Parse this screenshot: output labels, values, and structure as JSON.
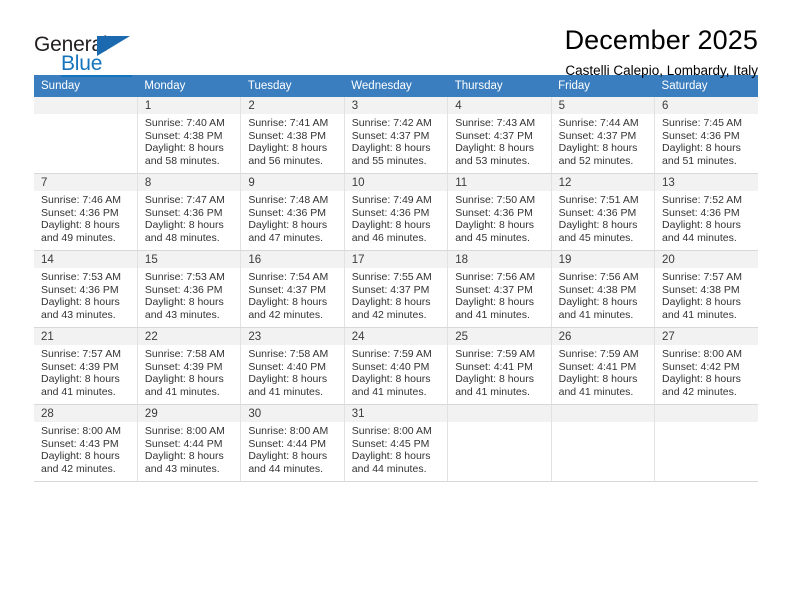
{
  "brand": {
    "name_top": "General",
    "name_bottom": "Blue",
    "accent_color": "#1574bb",
    "triangle_color": "#1b69af"
  },
  "header": {
    "title": "December 2025",
    "subtitle": "Castelli Calepio, Lombardy, Italy"
  },
  "calendar": {
    "header_bg": "#3a7ebf",
    "daynum_bg": "#f2f2f2",
    "weekdays": [
      "Sunday",
      "Monday",
      "Tuesday",
      "Wednesday",
      "Thursday",
      "Friday",
      "Saturday"
    ],
    "weeks": [
      [
        {
          "day": "",
          "sunrise": "",
          "sunset": "",
          "daylight": ""
        },
        {
          "day": "1",
          "sunrise": "Sunrise: 7:40 AM",
          "sunset": "Sunset: 4:38 PM",
          "daylight": "Daylight: 8 hours and 58 minutes."
        },
        {
          "day": "2",
          "sunrise": "Sunrise: 7:41 AM",
          "sunset": "Sunset: 4:38 PM",
          "daylight": "Daylight: 8 hours and 56 minutes."
        },
        {
          "day": "3",
          "sunrise": "Sunrise: 7:42 AM",
          "sunset": "Sunset: 4:37 PM",
          "daylight": "Daylight: 8 hours and 55 minutes."
        },
        {
          "day": "4",
          "sunrise": "Sunrise: 7:43 AM",
          "sunset": "Sunset: 4:37 PM",
          "daylight": "Daylight: 8 hours and 53 minutes."
        },
        {
          "day": "5",
          "sunrise": "Sunrise: 7:44 AM",
          "sunset": "Sunset: 4:37 PM",
          "daylight": "Daylight: 8 hours and 52 minutes."
        },
        {
          "day": "6",
          "sunrise": "Sunrise: 7:45 AM",
          "sunset": "Sunset: 4:36 PM",
          "daylight": "Daylight: 8 hours and 51 minutes."
        }
      ],
      [
        {
          "day": "7",
          "sunrise": "Sunrise: 7:46 AM",
          "sunset": "Sunset: 4:36 PM",
          "daylight": "Daylight: 8 hours and 49 minutes."
        },
        {
          "day": "8",
          "sunrise": "Sunrise: 7:47 AM",
          "sunset": "Sunset: 4:36 PM",
          "daylight": "Daylight: 8 hours and 48 minutes."
        },
        {
          "day": "9",
          "sunrise": "Sunrise: 7:48 AM",
          "sunset": "Sunset: 4:36 PM",
          "daylight": "Daylight: 8 hours and 47 minutes."
        },
        {
          "day": "10",
          "sunrise": "Sunrise: 7:49 AM",
          "sunset": "Sunset: 4:36 PM",
          "daylight": "Daylight: 8 hours and 46 minutes."
        },
        {
          "day": "11",
          "sunrise": "Sunrise: 7:50 AM",
          "sunset": "Sunset: 4:36 PM",
          "daylight": "Daylight: 8 hours and 45 minutes."
        },
        {
          "day": "12",
          "sunrise": "Sunrise: 7:51 AM",
          "sunset": "Sunset: 4:36 PM",
          "daylight": "Daylight: 8 hours and 45 minutes."
        },
        {
          "day": "13",
          "sunrise": "Sunrise: 7:52 AM",
          "sunset": "Sunset: 4:36 PM",
          "daylight": "Daylight: 8 hours and 44 minutes."
        }
      ],
      [
        {
          "day": "14",
          "sunrise": "Sunrise: 7:53 AM",
          "sunset": "Sunset: 4:36 PM",
          "daylight": "Daylight: 8 hours and 43 minutes."
        },
        {
          "day": "15",
          "sunrise": "Sunrise: 7:53 AM",
          "sunset": "Sunset: 4:36 PM",
          "daylight": "Daylight: 8 hours and 43 minutes."
        },
        {
          "day": "16",
          "sunrise": "Sunrise: 7:54 AM",
          "sunset": "Sunset: 4:37 PM",
          "daylight": "Daylight: 8 hours and 42 minutes."
        },
        {
          "day": "17",
          "sunrise": "Sunrise: 7:55 AM",
          "sunset": "Sunset: 4:37 PM",
          "daylight": "Daylight: 8 hours and 42 minutes."
        },
        {
          "day": "18",
          "sunrise": "Sunrise: 7:56 AM",
          "sunset": "Sunset: 4:37 PM",
          "daylight": "Daylight: 8 hours and 41 minutes."
        },
        {
          "day": "19",
          "sunrise": "Sunrise: 7:56 AM",
          "sunset": "Sunset: 4:38 PM",
          "daylight": "Daylight: 8 hours and 41 minutes."
        },
        {
          "day": "20",
          "sunrise": "Sunrise: 7:57 AM",
          "sunset": "Sunset: 4:38 PM",
          "daylight": "Daylight: 8 hours and 41 minutes."
        }
      ],
      [
        {
          "day": "21",
          "sunrise": "Sunrise: 7:57 AM",
          "sunset": "Sunset: 4:39 PM",
          "daylight": "Daylight: 8 hours and 41 minutes."
        },
        {
          "day": "22",
          "sunrise": "Sunrise: 7:58 AM",
          "sunset": "Sunset: 4:39 PM",
          "daylight": "Daylight: 8 hours and 41 minutes."
        },
        {
          "day": "23",
          "sunrise": "Sunrise: 7:58 AM",
          "sunset": "Sunset: 4:40 PM",
          "daylight": "Daylight: 8 hours and 41 minutes."
        },
        {
          "day": "24",
          "sunrise": "Sunrise: 7:59 AM",
          "sunset": "Sunset: 4:40 PM",
          "daylight": "Daylight: 8 hours and 41 minutes."
        },
        {
          "day": "25",
          "sunrise": "Sunrise: 7:59 AM",
          "sunset": "Sunset: 4:41 PM",
          "daylight": "Daylight: 8 hours and 41 minutes."
        },
        {
          "day": "26",
          "sunrise": "Sunrise: 7:59 AM",
          "sunset": "Sunset: 4:41 PM",
          "daylight": "Daylight: 8 hours and 41 minutes."
        },
        {
          "day": "27",
          "sunrise": "Sunrise: 8:00 AM",
          "sunset": "Sunset: 4:42 PM",
          "daylight": "Daylight: 8 hours and 42 minutes."
        }
      ],
      [
        {
          "day": "28",
          "sunrise": "Sunrise: 8:00 AM",
          "sunset": "Sunset: 4:43 PM",
          "daylight": "Daylight: 8 hours and 42 minutes."
        },
        {
          "day": "29",
          "sunrise": "Sunrise: 8:00 AM",
          "sunset": "Sunset: 4:44 PM",
          "daylight": "Daylight: 8 hours and 43 minutes."
        },
        {
          "day": "30",
          "sunrise": "Sunrise: 8:00 AM",
          "sunset": "Sunset: 4:44 PM",
          "daylight": "Daylight: 8 hours and 44 minutes."
        },
        {
          "day": "31",
          "sunrise": "Sunrise: 8:00 AM",
          "sunset": "Sunset: 4:45 PM",
          "daylight": "Daylight: 8 hours and 44 minutes."
        },
        {
          "day": "",
          "sunrise": "",
          "sunset": "",
          "daylight": ""
        },
        {
          "day": "",
          "sunrise": "",
          "sunset": "",
          "daylight": ""
        },
        {
          "day": "",
          "sunrise": "",
          "sunset": "",
          "daylight": ""
        }
      ]
    ]
  }
}
